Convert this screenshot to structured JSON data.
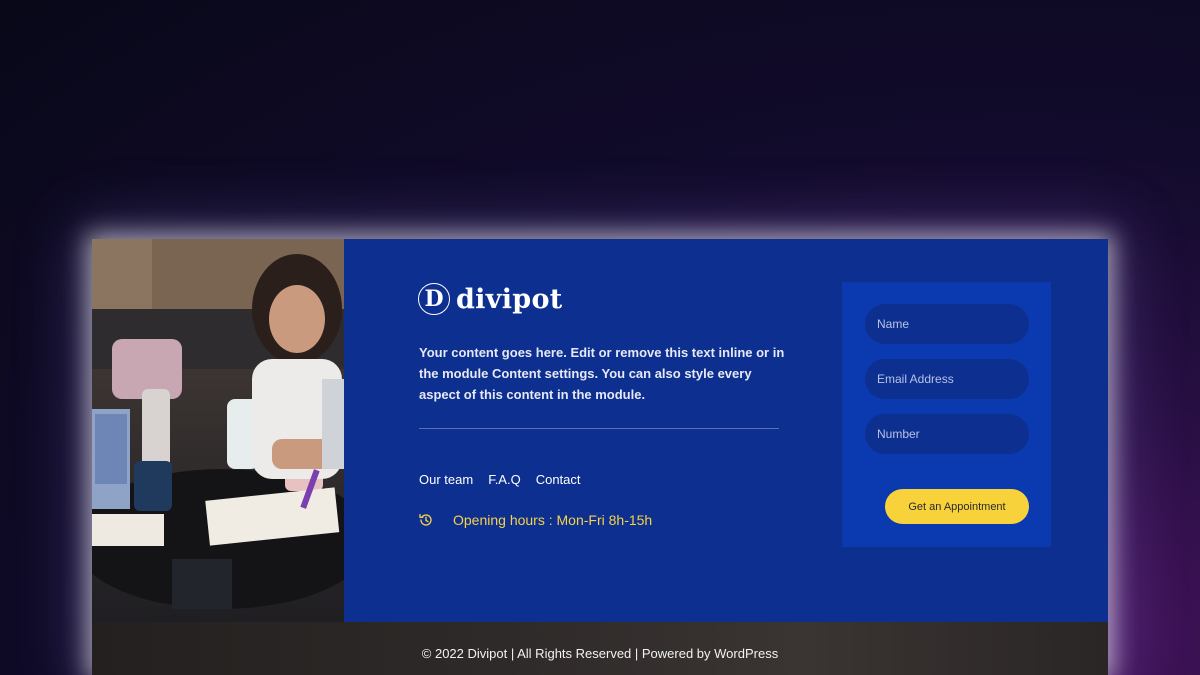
{
  "brand": {
    "mark": "D",
    "name": "divipot"
  },
  "content": {
    "description": "Your content goes here. Edit or remove this text inline or in the module Content settings. You can also style every aspect of this content in the module."
  },
  "nav": {
    "items": [
      "Our team",
      "F.A.Q",
      "Contact"
    ]
  },
  "hours": {
    "text": "Opening hours : Mon-Fri 8h-15h",
    "icon": "clock-history-icon"
  },
  "form": {
    "name_placeholder": "Name",
    "email_placeholder": "Email Address",
    "number_placeholder": "Number",
    "submit_label": "Get an Appointment"
  },
  "footer": {
    "text": "© 2022 Divipot | All Rights Reserved | Powered by WordPress"
  },
  "colors": {
    "primary_blue": "#0d2f8f",
    "form_blue": "#0b3ab0",
    "accent_yellow": "#f7d23a",
    "hours_yellow": "#f5d24a"
  }
}
